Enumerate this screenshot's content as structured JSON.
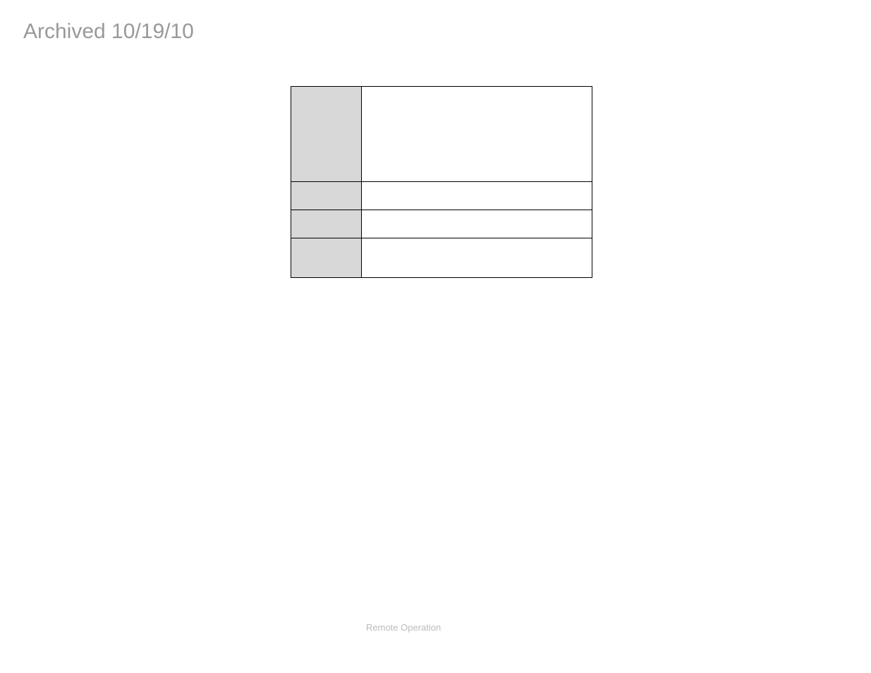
{
  "watermark": "Archived 10/19/10",
  "table": {
    "rows": [
      {
        "label": "",
        "value": ""
      },
      {
        "label": "",
        "value": ""
      },
      {
        "label": "",
        "value": ""
      },
      {
        "label": "",
        "value": ""
      }
    ]
  },
  "footer": "Remote Operation"
}
